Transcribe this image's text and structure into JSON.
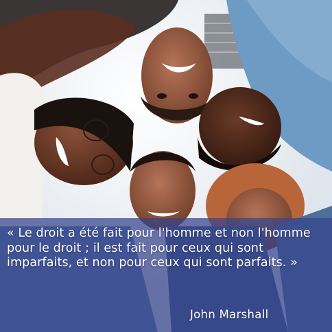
{
  "quote": {
    "text": "« Le droit a été fait pour l'homme et non l'homme pour le droit ; il est fait pour ceux qui sont imparfaits, et non pour ceux qui sont parfaits. »",
    "author": "John Marshall"
  },
  "colors": {
    "overlay": "#36428c",
    "text": "#ffffff"
  }
}
